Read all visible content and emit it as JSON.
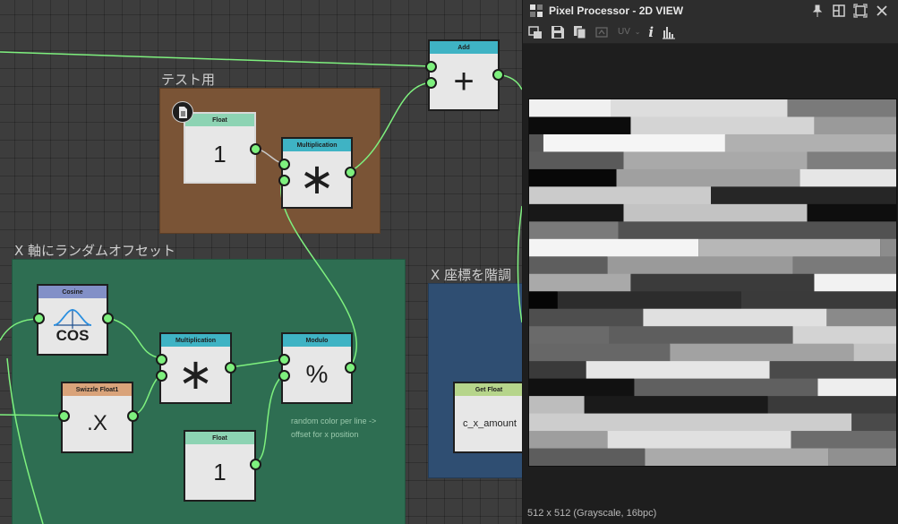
{
  "graph": {
    "groups": [
      {
        "id": "test",
        "title": "テスト用",
        "color": "#7a5436"
      },
      {
        "id": "rand",
        "title": "X 軸にランダムオフセット",
        "color": "#2e6e52"
      },
      {
        "id": "step",
        "title": "X 座標を階調",
        "color": "#2f4e72"
      }
    ],
    "nodes": {
      "add": {
        "header": "Add",
        "header_color": "#3fb3c4",
        "symbol": "+"
      },
      "float_test": {
        "header": "Float",
        "header_color": "#8dd3b3",
        "value": "1",
        "badge_icon": "document-icon"
      },
      "mult_test": {
        "header": "Multiplication",
        "header_color": "#3fb3c4",
        "symbol": "∗"
      },
      "cosine": {
        "header": "Cosine",
        "header_color": "#8290c7",
        "label": "COS",
        "icon": "cosine-curve-icon"
      },
      "swizzle": {
        "header": "Swizzle Float1",
        "header_color": "#d9a37a",
        "value": ".X"
      },
      "mult_rand": {
        "header": "Multiplication",
        "header_color": "#3fb3c4",
        "symbol": "∗"
      },
      "modulo": {
        "header": "Modulo",
        "header_color": "#3fb3c4",
        "symbol": "%"
      },
      "float_rand": {
        "header": "Float",
        "header_color": "#8dd3b3",
        "value": "1"
      },
      "get_float": {
        "header": "Get Float",
        "header_color": "#b6d58b",
        "value": "c_x_amount"
      }
    },
    "comment": [
      "random color per line ->",
      "offset for x position"
    ],
    "wire_color": "#7ef07e"
  },
  "panel": {
    "title": "Pixel Processor - 2D VIEW",
    "toolbar": {
      "uv_label": "UV",
      "info_label": "i"
    },
    "status": "512 x 512 (Grayscale, 16bpc)"
  },
  "preview_rows": [
    [
      [
        0,
        46,
        "#f0f0f0"
      ],
      [
        46,
        145,
        "#dddddd"
      ],
      [
        145,
        206,
        "#7a7a7a"
      ]
    ],
    [
      [
        0,
        57,
        "#0c0c0c"
      ],
      [
        57,
        160,
        "#d4d4d4"
      ],
      [
        160,
        206,
        "#9a9a9a"
      ]
    ],
    [
      [
        0,
        8,
        "#555555"
      ],
      [
        8,
        110,
        "#f5f5f5"
      ],
      [
        110,
        206,
        "#b0b0b0"
      ]
    ],
    [
      [
        0,
        53,
        "#5a5a5a"
      ],
      [
        53,
        156,
        "#a9a9a9"
      ],
      [
        156,
        206,
        "#7e7e7e"
      ]
    ],
    [
      [
        0,
        49,
        "#080808"
      ],
      [
        49,
        152,
        "#a0a0a0"
      ],
      [
        152,
        206,
        "#e6e6e6"
      ]
    ],
    [
      [
        0,
        102,
        "#cbcbcb"
      ],
      [
        102,
        206,
        "#262626"
      ]
    ],
    [
      [
        0,
        53,
        "#181818"
      ],
      [
        53,
        156,
        "#c3c3c3"
      ],
      [
        156,
        206,
        "#0e0e0e"
      ]
    ],
    [
      [
        0,
        50,
        "#7a7a7a"
      ],
      [
        50,
        206,
        "#525252"
      ]
    ],
    [
      [
        0,
        95,
        "#f4f4f4"
      ],
      [
        95,
        197,
        "#b7b7b7"
      ],
      [
        197,
        206,
        "#8c8c8c"
      ]
    ],
    [
      [
        0,
        44,
        "#5e5e5e"
      ],
      [
        44,
        148,
        "#9a9a9a"
      ],
      [
        148,
        206,
        "#7a7a7a"
      ]
    ],
    [
      [
        0,
        57,
        "#a9a9a9"
      ],
      [
        57,
        160,
        "#3b3b3b"
      ],
      [
        160,
        206,
        "#f2f2f2"
      ]
    ],
    [
      [
        0,
        16,
        "#050505"
      ],
      [
        16,
        119,
        "#2c2c2c"
      ],
      [
        119,
        206,
        "#3a3a3a"
      ]
    ],
    [
      [
        0,
        64,
        "#4e4e4e"
      ],
      [
        64,
        167,
        "#e0e0e0"
      ],
      [
        167,
        206,
        "#8a8a8a"
      ]
    ],
    [
      [
        0,
        45,
        "#6a6a6a"
      ],
      [
        45,
        148,
        "#5e5e5e"
      ],
      [
        148,
        206,
        "#d3d3d3"
      ]
    ],
    [
      [
        0,
        79,
        "#676767"
      ],
      [
        79,
        182,
        "#a2a2a2"
      ],
      [
        182,
        206,
        "#c4c4c4"
      ]
    ],
    [
      [
        0,
        32,
        "#3a3a3a"
      ],
      [
        32,
        135,
        "#e6e6e6"
      ],
      [
        135,
        206,
        "#4a4a4a"
      ]
    ],
    [
      [
        0,
        59,
        "#111111"
      ],
      [
        59,
        162,
        "#606060"
      ],
      [
        162,
        206,
        "#eeeeee"
      ]
    ],
    [
      [
        0,
        31,
        "#bdbdbd"
      ],
      [
        31,
        134,
        "#1a1a1a"
      ],
      [
        134,
        206,
        "#3a3a3a"
      ]
    ],
    [
      [
        0,
        181,
        "#cdcdcd"
      ],
      [
        181,
        206,
        "#4a4a4a"
      ]
    ],
    [
      [
        0,
        44,
        "#9e9e9e"
      ],
      [
        44,
        147,
        "#e0e0e0"
      ],
      [
        147,
        206,
        "#6c6c6c"
      ]
    ],
    [
      [
        0,
        65,
        "#5d5d5d"
      ],
      [
        65,
        168,
        "#aaaaaa"
      ],
      [
        168,
        206,
        "#909090"
      ]
    ]
  ]
}
